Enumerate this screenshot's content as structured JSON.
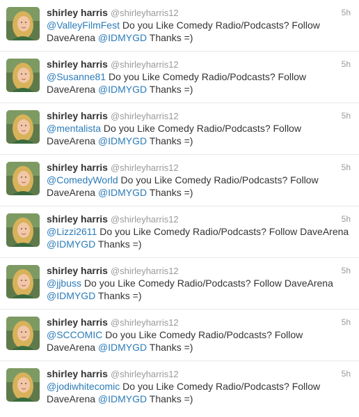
{
  "tweets": [
    {
      "name": "shirley harris",
      "handle": "@shirleyharris12",
      "time": "5h",
      "mention": "@ValleyFilmFest",
      "text": " Do you Like Comedy Radio/Podcasts? Follow DaveArena ",
      "tag": "@IDMYGD",
      "suffix": " Thanks =)"
    },
    {
      "name": "shirley harris",
      "handle": "@shirleyharris12",
      "time": "5h",
      "mention": "@Susanne81",
      "text": " Do you Like Comedy Radio/Podcasts? Follow DaveArena ",
      "tag": "@IDMYGD",
      "suffix": " Thanks =)"
    },
    {
      "name": "shirley harris",
      "handle": "@shirleyharris12",
      "time": "5h",
      "mention": "@mentalista",
      "text": " Do you Like Comedy Radio/Podcasts? Follow DaveArena ",
      "tag": "@IDMYGD",
      "suffix": " Thanks =)"
    },
    {
      "name": "shirley harris",
      "handle": "@shirleyharris12",
      "time": "5h",
      "mention": "@ComedyWorld",
      "text": " Do you Like Comedy Radio/Podcasts? Follow DaveArena ",
      "tag": "@IDMYGD",
      "suffix": " Thanks =)"
    },
    {
      "name": "shirley harris",
      "handle": "@shirleyharris12",
      "time": "5h",
      "mention": "@Lizzi2611",
      "text": " Do you Like Comedy Radio/Podcasts? Follow DaveArena ",
      "tag": "@IDMYGD",
      "suffix": " Thanks =)"
    },
    {
      "name": "shirley harris",
      "handle": "@shirleyharris12",
      "time": "5h",
      "mention": "@jjbuss",
      "text": " Do you Like Comedy Radio/Podcasts? Follow DaveArena ",
      "tag": "@IDMYGD",
      "suffix": " Thanks =)"
    },
    {
      "name": "shirley harris",
      "handle": "@shirleyharris12",
      "time": "5h",
      "mention": "@SCCOMIC",
      "text": " Do you Like Comedy Radio/Podcasts? Follow DaveArena ",
      "tag": "@IDMYGD",
      "suffix": " Thanks =)"
    },
    {
      "name": "shirley harris",
      "handle": "@shirleyharris12",
      "time": "5h",
      "mention": "@jodiwhitecomic",
      "text": " Do you Like Comedy Radio/Podcasts? Follow DaveArena ",
      "tag": "@IDMYGD",
      "suffix": " Thanks =)"
    }
  ],
  "colors": {
    "link": "#2b7bb9",
    "name": "#333333",
    "meta": "#999999",
    "divider": "#e8e8e8"
  },
  "icons": {
    "avatar": "avatar-photo"
  }
}
